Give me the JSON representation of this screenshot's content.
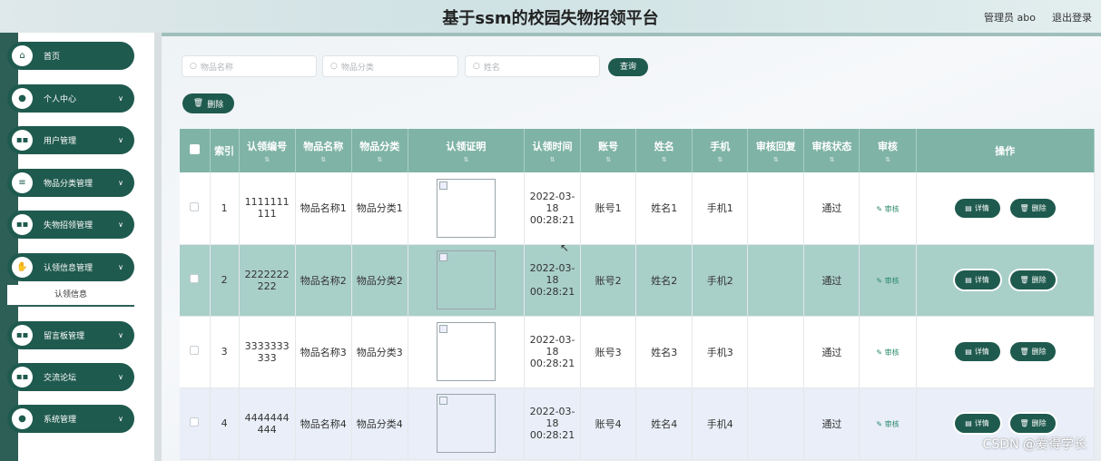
{
  "header": {
    "title": "基于ssm的校园失物招领平台",
    "admin": "管理员 abo",
    "logout": "退出登录"
  },
  "sidebar": {
    "items": [
      {
        "label": "首页",
        "icon": "home-icon",
        "chevron": false
      },
      {
        "label": "个人中心",
        "icon": "user-icon",
        "chevron": true
      },
      {
        "label": "用户管理",
        "icon": "grid-icon",
        "chevron": true
      },
      {
        "label": "物品分类管理",
        "icon": "list-icon",
        "chevron": true
      },
      {
        "label": "失物招领管理",
        "icon": "grid-icon",
        "chevron": true
      },
      {
        "label": "认领信息管理",
        "icon": "thumb-icon",
        "chevron": true
      },
      {
        "label": "留言板管理",
        "icon": "grid-icon",
        "chevron": true
      },
      {
        "label": "交流论坛",
        "icon": "grid-icon",
        "chevron": true
      },
      {
        "label": "系统管理",
        "icon": "user-icon",
        "chevron": true
      }
    ],
    "submenu": "认领信息"
  },
  "search": {
    "item_name_placeholder": "物品名称",
    "category_placeholder": "物品分类",
    "name_placeholder": "姓名",
    "query_button": "查询"
  },
  "toolbar": {
    "delete_label": "删除"
  },
  "table": {
    "columns": [
      "索引",
      "认领编号",
      "物品名称",
      "物品分类",
      "认领证明",
      "认领时间",
      "账号",
      "姓名",
      "手机",
      "审核回复",
      "审核状态",
      "审核",
      "操作"
    ],
    "rows": [
      {
        "index": "1",
        "claim_no": "1111111111",
        "item": "物品名称1",
        "category": "物品分类1",
        "time": "2022-03-18 00:28:21",
        "account": "账号1",
        "name": "姓名1",
        "phone": "手机1",
        "reply": "",
        "status": "通过",
        "audit": "审核"
      },
      {
        "index": "2",
        "claim_no": "2222222222",
        "item": "物品名称2",
        "category": "物品分类2",
        "time": "2022-03-18 00:28:21",
        "account": "账号2",
        "name": "姓名2",
        "phone": "手机2",
        "reply": "",
        "status": "通过",
        "audit": "审核"
      },
      {
        "index": "3",
        "claim_no": "3333333333",
        "item": "物品名称3",
        "category": "物品分类3",
        "time": "2022-03-18 00:28:21",
        "account": "账号3",
        "name": "姓名3",
        "phone": "手机3",
        "reply": "",
        "status": "通过",
        "audit": "审核"
      },
      {
        "index": "4",
        "claim_no": "4444444444",
        "item": "物品名称4",
        "category": "物品分类4",
        "time": "2022-03-18 00:28:21",
        "account": "账号4",
        "name": "姓名4",
        "phone": "手机4",
        "reply": "",
        "status": "通过",
        "audit": "审核"
      }
    ],
    "detail_label": "详情",
    "delete_label": "删除"
  },
  "watermark": "CSDN @爱得学长",
  "colors": {
    "primary": "#1f5a4e",
    "header_row": "#7fb3a5",
    "highlight_row": "#a9cfc9"
  }
}
